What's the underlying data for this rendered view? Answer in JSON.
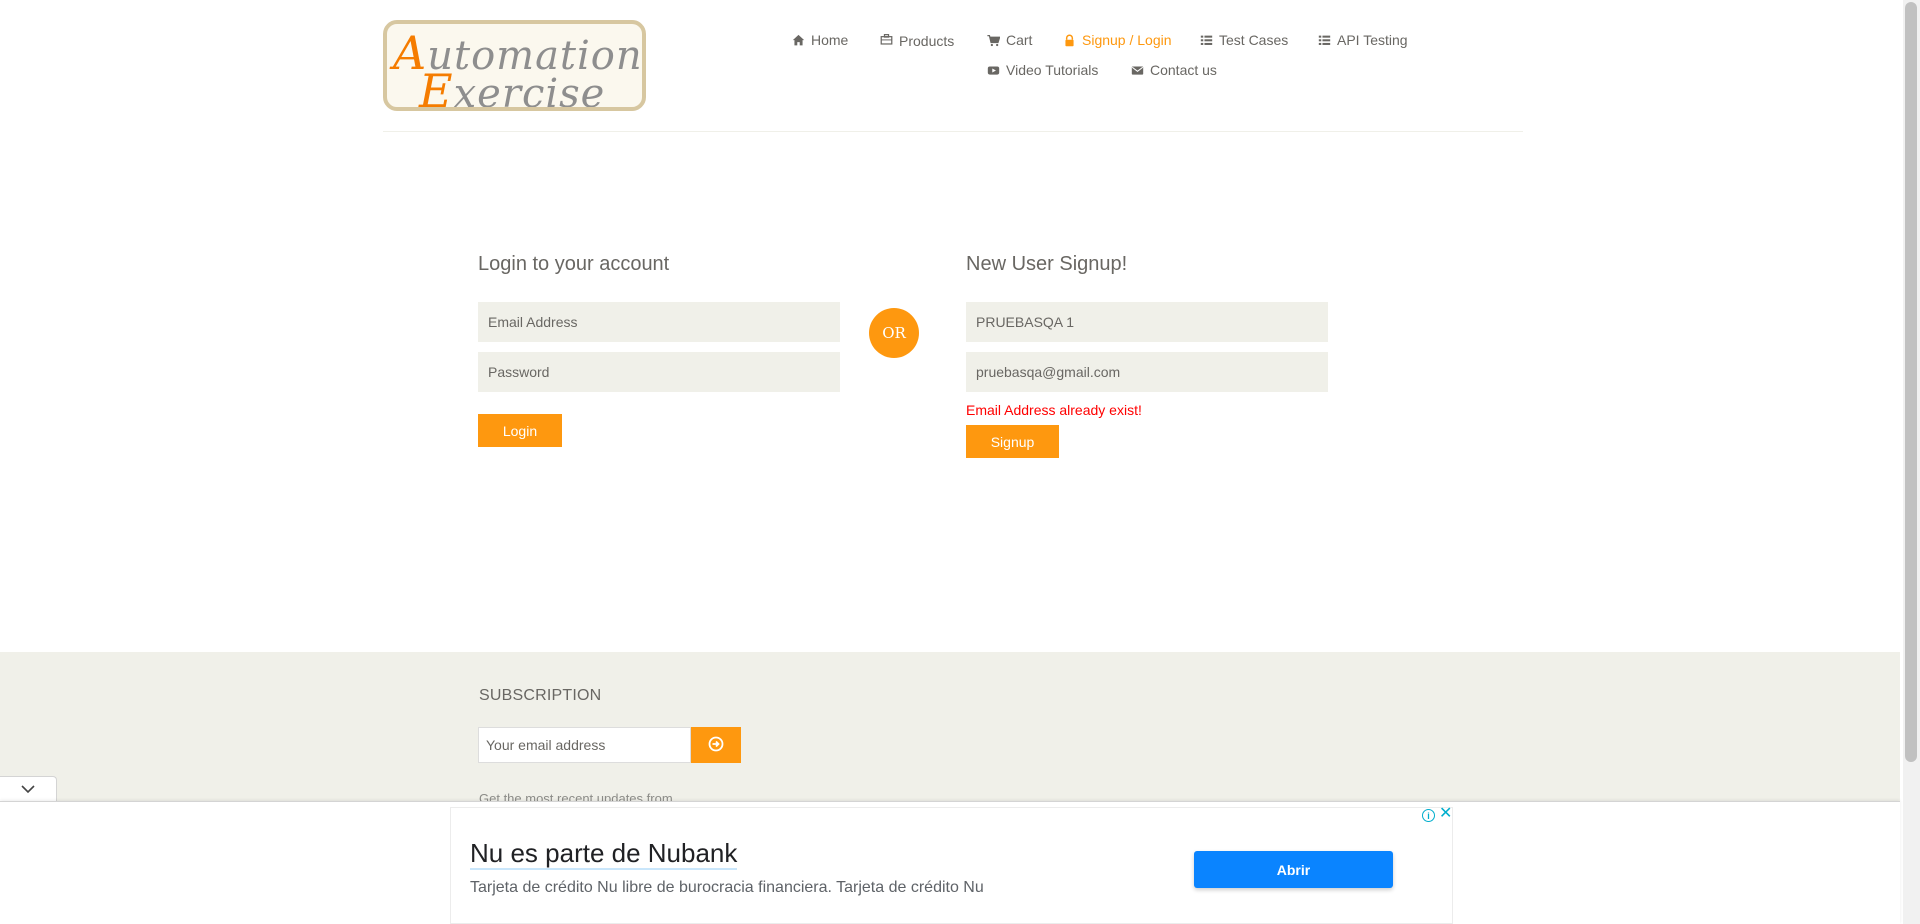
{
  "logo": {
    "text_line1": "Automation",
    "text_line2": "Exercise"
  },
  "nav": {
    "home": "Home",
    "products": "Products",
    "cart": "Cart",
    "signup_login": "Signup / Login",
    "test_cases": "Test Cases",
    "api_testing": "API Testing",
    "video_tutorials": "Video Tutorials",
    "contact_us": "Contact us"
  },
  "login": {
    "title": "Login to your account",
    "email_placeholder": "Email Address",
    "password_placeholder": "Password",
    "button": "Login"
  },
  "or_label": "OR",
  "signup": {
    "title": "New User Signup!",
    "name_value": "PRUEBASQA 1",
    "email_value": "pruebasqa@gmail.com",
    "error": "Email Address already exist!",
    "button": "Signup"
  },
  "footer": {
    "subscription_title": "SUBSCRIPTION",
    "email_placeholder": "Your email address",
    "note": "Get the most recent updates from"
  },
  "ad": {
    "headline": "Nu es parte de Nubank",
    "description": "Tarjeta de crédito Nu libre de burocracia financiera. Tarjeta de crédito Nu",
    "cta": "Abrir"
  },
  "colors": {
    "accent": "#fe980f",
    "error": "#ff0000",
    "ad_button": "#0a84ff"
  }
}
